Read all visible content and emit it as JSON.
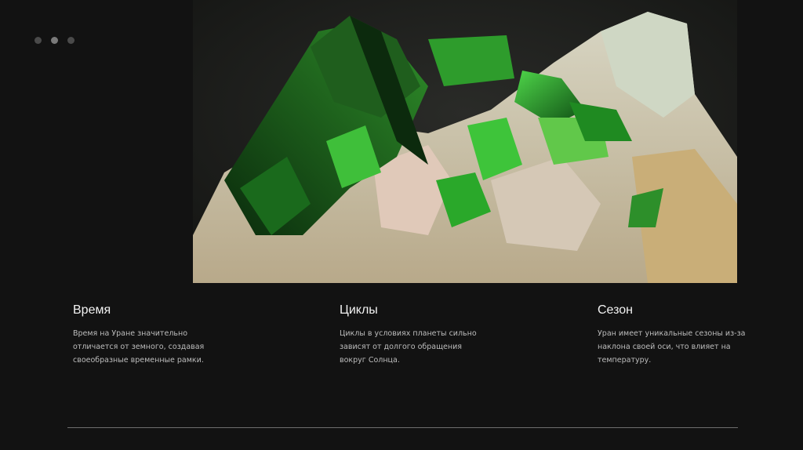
{
  "slider": {
    "dots": 3,
    "active_index": 1
  },
  "image": {
    "subject": "green-crystals-on-rock"
  },
  "columns": [
    {
      "title": "Время",
      "text": "Время на Уране значительно отличается от земного, создавая своеобразные временные рамки."
    },
    {
      "title": "Циклы",
      "text": "Циклы в условиях планеты сильно зависят от долгого обращения вокруг Солнца."
    },
    {
      "title": "Сезон",
      "text": "Уран имеет уникальные сезоны из-за наклона своей оси, что влияет на температуру."
    }
  ],
  "colors": {
    "background": "#121212",
    "title": "#f2f2f2",
    "text": "#bdbdbd",
    "rule": "#6d6d6d"
  }
}
